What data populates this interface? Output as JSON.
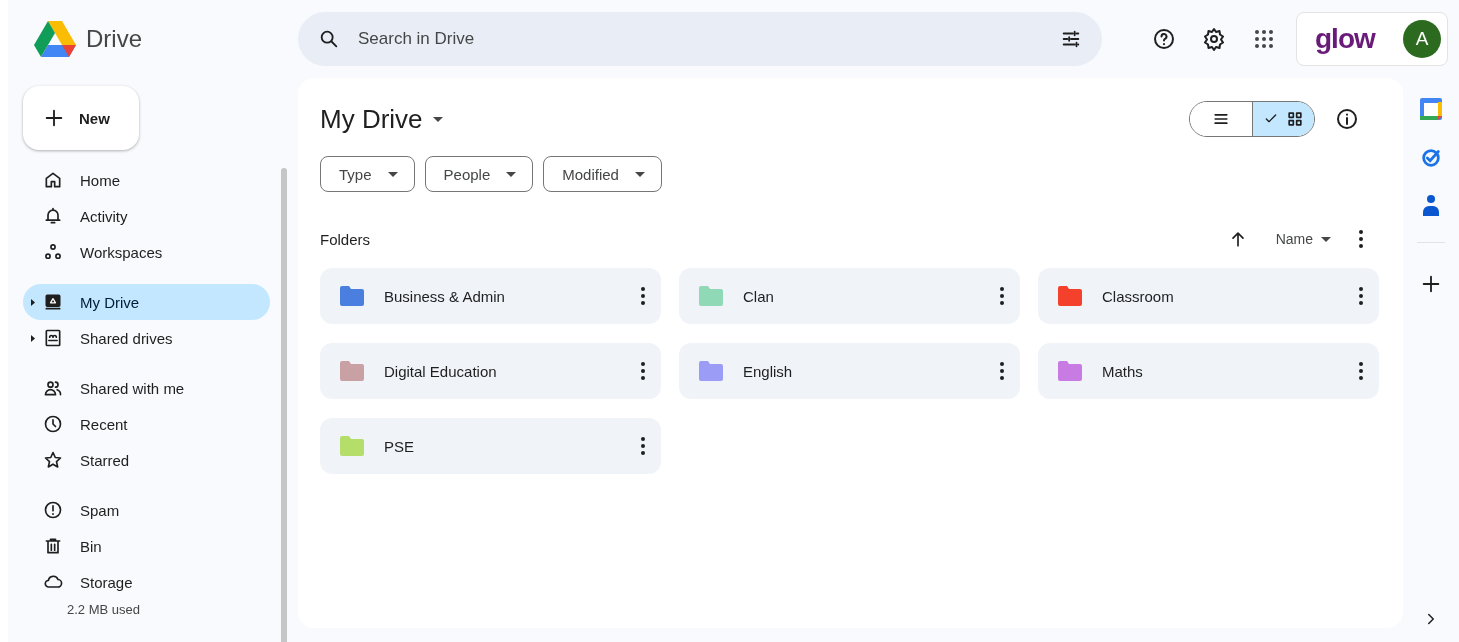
{
  "app": {
    "name": "Drive"
  },
  "search": {
    "placeholder": "Search in Drive"
  },
  "account": {
    "brand": "glow",
    "avatar_letter": "A"
  },
  "new_button": {
    "label": "New"
  },
  "nav_groups": [
    [
      {
        "label": "Home",
        "selected": false,
        "expandable": false
      },
      {
        "label": "Activity",
        "selected": false,
        "expandable": false
      },
      {
        "label": "Workspaces",
        "selected": false,
        "expandable": false
      }
    ],
    [
      {
        "label": "My Drive",
        "selected": true,
        "expandable": true
      },
      {
        "label": "Shared drives",
        "selected": false,
        "expandable": true
      }
    ],
    [
      {
        "label": "Shared with me",
        "selected": false,
        "expandable": false
      },
      {
        "label": "Recent",
        "selected": false,
        "expandable": false
      },
      {
        "label": "Starred",
        "selected": false,
        "expandable": false
      }
    ],
    [
      {
        "label": "Spam",
        "selected": false,
        "expandable": false
      },
      {
        "label": "Bin",
        "selected": false,
        "expandable": false
      },
      {
        "label": "Storage",
        "selected": false,
        "expandable": false
      }
    ]
  ],
  "storage_used": "2.2 MB used",
  "page_title": "My Drive",
  "view_modes": [
    {
      "selected": false
    },
    {
      "selected": true
    }
  ],
  "filters": [
    {
      "label": "Type"
    },
    {
      "label": "People"
    },
    {
      "label": "Modified"
    }
  ],
  "section_title": "Folders",
  "sort": {
    "label": "Name"
  },
  "folders": [
    {
      "name": "Business & Admin",
      "color": "#4a7fe0"
    },
    {
      "name": "Clan",
      "color": "#8fd9b6"
    },
    {
      "name": "Classroom",
      "color": "#f4412c"
    },
    {
      "name": "Digital Education",
      "color": "#c9a0a4"
    },
    {
      "name": "English",
      "color": "#9b9cf5"
    },
    {
      "name": "Maths",
      "color": "#c77be3"
    },
    {
      "name": "PSE",
      "color": "#b5dd6a"
    }
  ]
}
